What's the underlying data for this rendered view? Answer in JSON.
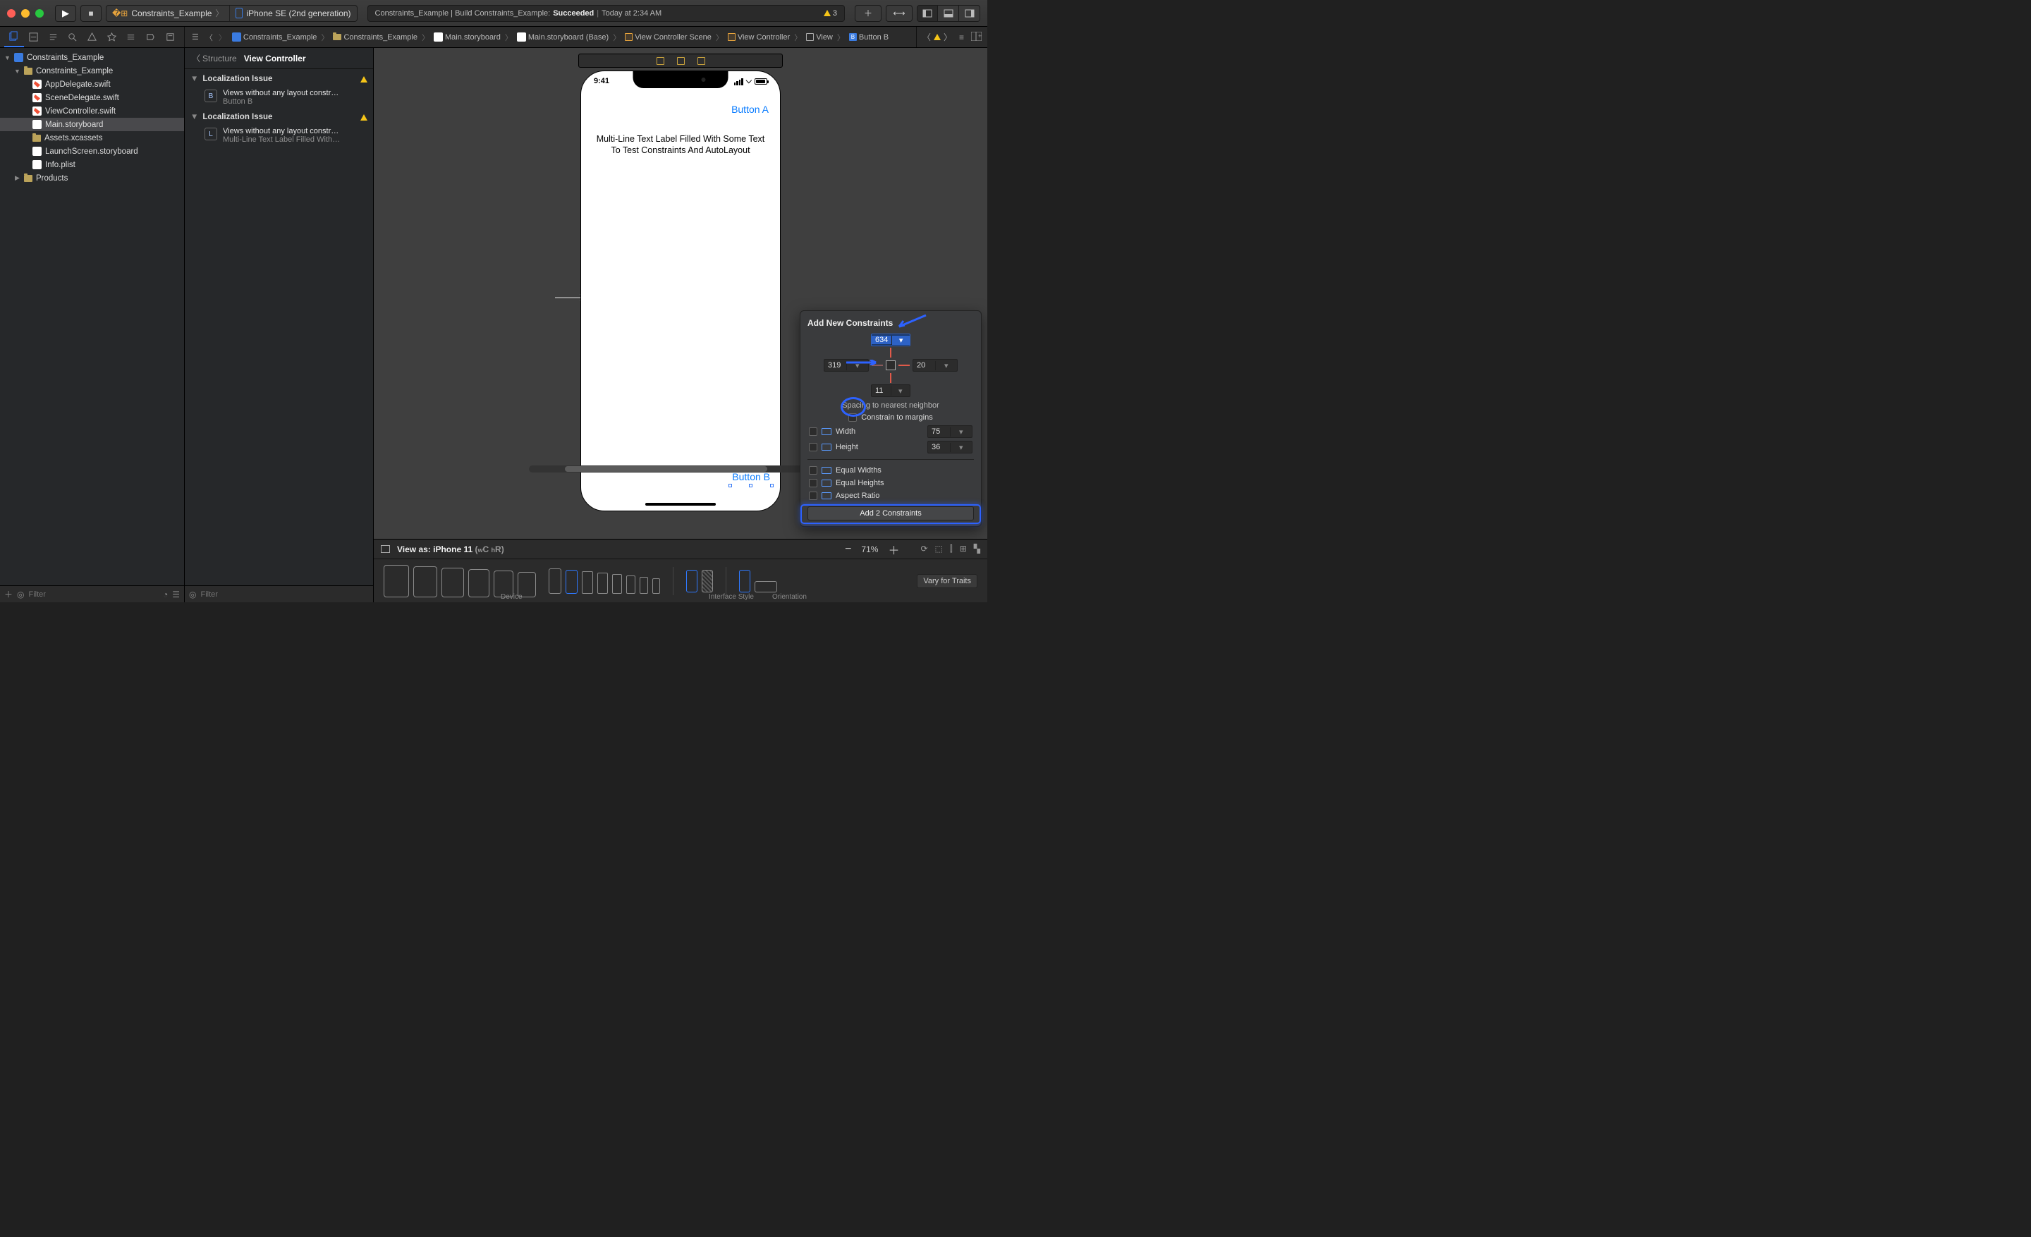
{
  "toolbar": {
    "scheme_target": "Constraints_Example",
    "scheme_device": "iPhone SE (2nd generation)",
    "status_prefix": "Constraints_Example | Build Constraints_Example:",
    "status_result": "Succeeded",
    "status_time": "Today at 2:34 AM",
    "warn_count": "3"
  },
  "navigator": {
    "project": "Constraints_Example",
    "group": "Constraints_Example",
    "files": [
      "AppDelegate.swift",
      "SceneDelegate.swift",
      "ViewController.swift",
      "Main.storyboard",
      "Assets.xcassets",
      "LaunchScreen.storyboard",
      "Info.plist"
    ],
    "products": "Products",
    "filter_placeholder": "Filter"
  },
  "outline": {
    "back": "Structure",
    "current": "View Controller",
    "section": "Localization Issue",
    "issue1_title": "Views without any layout constr…",
    "issue1_sub": "Button B",
    "issue2_title": "Views without any layout constr…",
    "issue2_sub": "Multi-Line Text Label Filled With…",
    "filter_placeholder": "Filter"
  },
  "breadcrumb": {
    "c1": "Constraints_Example",
    "c2": "Constraints_Example",
    "c3": "Main.storyboard",
    "c4": "Main.storyboard (Base)",
    "c5": "View Controller Scene",
    "c6": "View Controller",
    "c7": "View",
    "c8": "Button B"
  },
  "canvas": {
    "status_time": "9:41",
    "button_a": "Button A",
    "label": "Multi-Line Text Label Filled With Some Text To Test Constraints And AutoLayout",
    "button_b": "Button B"
  },
  "popover": {
    "title": "Add New Constraints",
    "top": "634",
    "left": "319",
    "right": "20",
    "bottom": "11",
    "hint": "Spacing to nearest neighbor",
    "margins": "Constrain to margins",
    "width_label": "Width",
    "height_label": "Height",
    "width_val": "75",
    "height_val": "36",
    "eq_w": "Equal Widths",
    "eq_h": "Equal Heights",
    "aspect": "Aspect Ratio",
    "add": "Add 2 Constraints"
  },
  "bottom": {
    "view_as": "View as: iPhone 11",
    "wC": "C",
    "hR": "R",
    "zoom": "71%",
    "device_label": "Device",
    "style_label": "Interface Style",
    "orient_label": "Orientation",
    "vary": "Vary for Traits"
  }
}
